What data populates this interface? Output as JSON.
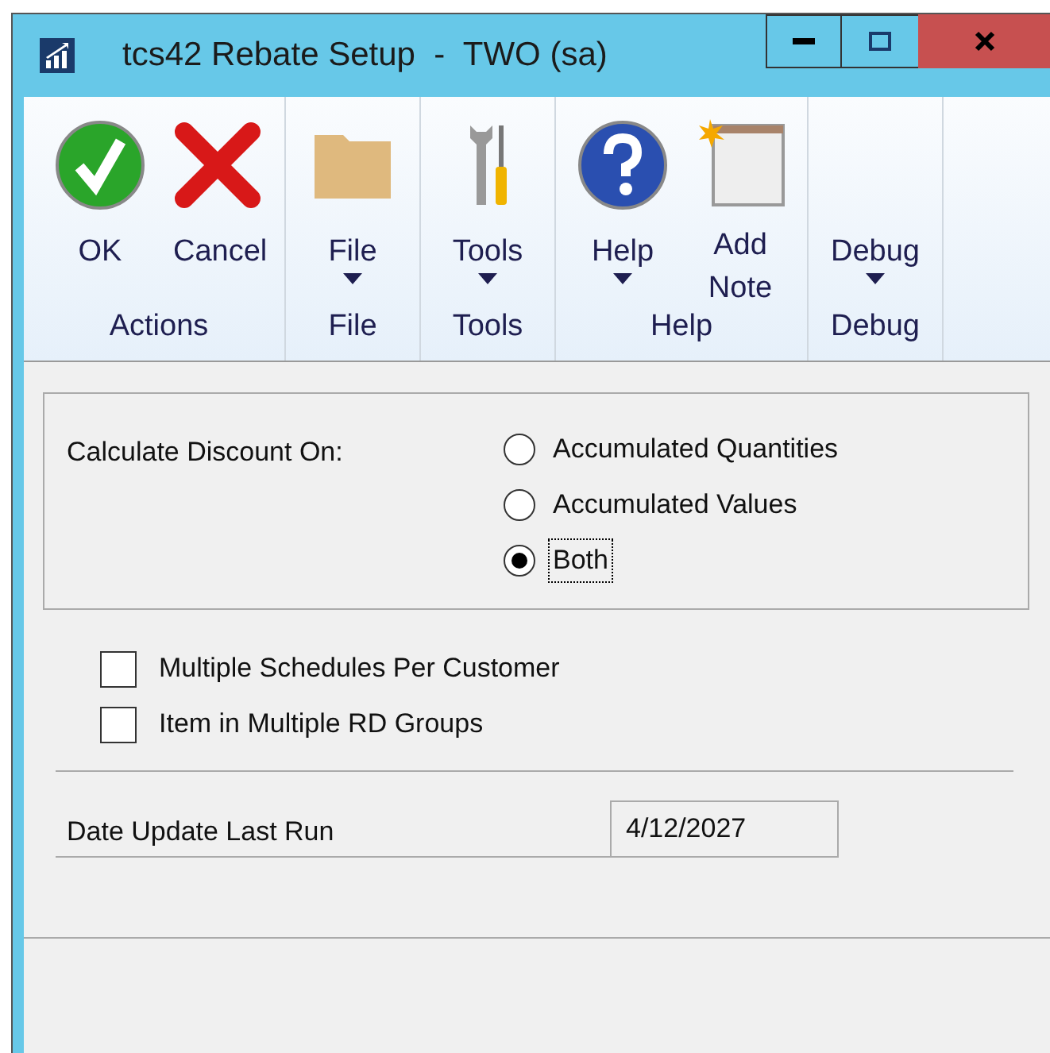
{
  "window": {
    "title": "tcs42 Rebate Setup  -  TWO (sa)"
  },
  "ribbon": {
    "groups": [
      {
        "label": "Actions",
        "buttons": [
          {
            "label": "OK",
            "kind": "ok"
          },
          {
            "label": "Cancel",
            "kind": "cancel"
          }
        ]
      },
      {
        "label": "File",
        "buttons": [
          {
            "label": "File",
            "kind": "folder",
            "dropdown": true
          }
        ]
      },
      {
        "label": "Tools",
        "buttons": [
          {
            "label": "Tools",
            "kind": "tools",
            "dropdown": true
          }
        ]
      },
      {
        "label": "Help",
        "buttons": [
          {
            "label": "Help",
            "kind": "help",
            "dropdown": true
          },
          {
            "label": "Add Note",
            "kind": "note"
          }
        ]
      },
      {
        "label": "Debug",
        "buttons": [
          {
            "label": "Debug",
            "kind": "none",
            "dropdown": true
          }
        ]
      }
    ]
  },
  "discount": {
    "label": "Calculate Discount On:",
    "options": [
      {
        "label": "Accumulated Quantities",
        "selected": false,
        "focused": false
      },
      {
        "label": "Accumulated Values",
        "selected": false,
        "focused": false
      },
      {
        "label": "Both",
        "selected": true,
        "focused": true
      }
    ]
  },
  "checkboxes": [
    {
      "label": "Multiple Schedules Per Customer",
      "checked": false
    },
    {
      "label": "Item in Multiple RD Groups",
      "checked": false
    }
  ],
  "date_update": {
    "label": "Date Update Last Run",
    "value": "4/12/2027"
  }
}
